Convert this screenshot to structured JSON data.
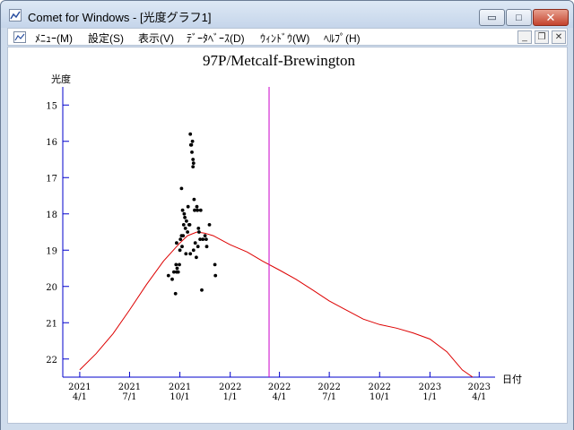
{
  "window": {
    "title": "Comet for Windows - [光度グラフ1]",
    "buttons": {
      "minimize": "▭",
      "maximize": "□",
      "close": "✕"
    }
  },
  "menubar": {
    "items": [
      {
        "label": "ﾒﾆｭｰ(M)"
      },
      {
        "label": "設定(S)"
      },
      {
        "label": "表示(V)"
      },
      {
        "label": "ﾃﾞｰﾀﾍﾞｰｽ(D)"
      },
      {
        "label": "ｳｨﾝﾄﾞｳ(W)"
      },
      {
        "label": "ﾍﾙﾌﾟ(H)"
      }
    ],
    "mdi_buttons": {
      "minimize": "_",
      "restore": "❐",
      "close": "✕"
    }
  },
  "chart_data": {
    "type": "scatter",
    "title": "97P/Metcalf-Brewington",
    "ylabel": "光度",
    "xlabel": "日付",
    "ylim": [
      22.5,
      14.5
    ],
    "xlim": [
      "2021-03-01",
      "2023-04-30"
    ],
    "y_inverted": true,
    "y_ticks": [
      "15",
      "16",
      "17",
      "18",
      "19",
      "20",
      "21",
      "22"
    ],
    "x_ticks": [
      {
        "date": "2021-04-01",
        "year": "2021",
        "md": "4/1"
      },
      {
        "date": "2021-07-01",
        "year": "2021",
        "md": "7/1"
      },
      {
        "date": "2021-10-01",
        "year": "2021",
        "md": "10/1"
      },
      {
        "date": "2022-01-01",
        "year": "2022",
        "md": "1/1"
      },
      {
        "date": "2022-04-01",
        "year": "2022",
        "md": "4/1"
      },
      {
        "date": "2022-07-01",
        "year": "2022",
        "md": "7/1"
      },
      {
        "date": "2022-10-01",
        "year": "2022",
        "md": "10/1"
      },
      {
        "date": "2023-01-01",
        "year": "2023",
        "md": "1/1"
      },
      {
        "date": "2023-04-01",
        "year": "2023",
        "md": "4/1"
      }
    ],
    "marker_line_date": "2022-03-13",
    "series": [
      {
        "kind": "observations",
        "color": "#000000",
        "points": [
          [
            "2021-09-10",
            19.7
          ],
          [
            "2021-09-17",
            19.8
          ],
          [
            "2021-09-20",
            19.6
          ],
          [
            "2021-09-23",
            20.2
          ],
          [
            "2021-09-24",
            19.4
          ],
          [
            "2021-09-25",
            19.6
          ],
          [
            "2021-09-25",
            18.8
          ],
          [
            "2021-09-26",
            19.5
          ],
          [
            "2021-09-28",
            19.6
          ],
          [
            "2021-09-30",
            19.4
          ],
          [
            "2021-10-01",
            19.0
          ],
          [
            "2021-10-02",
            18.7
          ],
          [
            "2021-10-04",
            17.3
          ],
          [
            "2021-10-04",
            18.6
          ],
          [
            "2021-10-05",
            18.9
          ],
          [
            "2021-10-06",
            17.9
          ],
          [
            "2021-10-07",
            18.6
          ],
          [
            "2021-10-08",
            18.3
          ],
          [
            "2021-10-09",
            18.0
          ],
          [
            "2021-10-10",
            18.1
          ],
          [
            "2021-10-11",
            18.4
          ],
          [
            "2021-10-12",
            19.1
          ],
          [
            "2021-10-13",
            18.2
          ],
          [
            "2021-10-15",
            18.5
          ],
          [
            "2021-10-16",
            17.8
          ],
          [
            "2021-10-18",
            18.3
          ],
          [
            "2021-10-19",
            18.3
          ],
          [
            "2021-10-20",
            19.1
          ],
          [
            "2021-10-20",
            15.8
          ],
          [
            "2021-10-21",
            16.1
          ],
          [
            "2021-10-22",
            16.1
          ],
          [
            "2021-10-23",
            16.3
          ],
          [
            "2021-10-24",
            16.0
          ],
          [
            "2021-10-25",
            16.7
          ],
          [
            "2021-10-25",
            16.5
          ],
          [
            "2021-10-26",
            16.6
          ],
          [
            "2021-10-26",
            19.0
          ],
          [
            "2021-10-27",
            17.6
          ],
          [
            "2021-10-28",
            17.9
          ],
          [
            "2021-10-29",
            18.8
          ],
          [
            "2021-10-31",
            19.2
          ],
          [
            "2021-11-01",
            17.8
          ],
          [
            "2021-11-02",
            17.9
          ],
          [
            "2021-11-03",
            18.9
          ],
          [
            "2021-11-04",
            18.4
          ],
          [
            "2021-11-05",
            18.5
          ],
          [
            "2021-11-07",
            18.7
          ],
          [
            "2021-11-08",
            17.9
          ],
          [
            "2021-11-10",
            20.1
          ],
          [
            "2021-11-12",
            18.7
          ],
          [
            "2021-11-16",
            18.6
          ],
          [
            "2021-11-18",
            18.7
          ],
          [
            "2021-11-19",
            18.9
          ],
          [
            "2021-11-24",
            18.3
          ],
          [
            "2021-12-04",
            19.4
          ],
          [
            "2021-12-05",
            19.7
          ]
        ]
      },
      {
        "kind": "prediction",
        "color": "#dd0000",
        "points": [
          [
            "2021-04-01",
            22.3
          ],
          [
            "2021-05-01",
            21.85
          ],
          [
            "2021-06-01",
            21.3
          ],
          [
            "2021-07-01",
            20.65
          ],
          [
            "2021-08-01",
            19.95
          ],
          [
            "2021-09-01",
            19.3
          ],
          [
            "2021-10-01",
            18.8
          ],
          [
            "2021-10-15",
            18.6
          ],
          [
            "2021-11-01",
            18.5
          ],
          [
            "2021-11-15",
            18.53
          ],
          [
            "2021-12-01",
            18.6
          ],
          [
            "2022-01-01",
            18.85
          ],
          [
            "2022-02-01",
            19.05
          ],
          [
            "2022-03-01",
            19.3
          ],
          [
            "2022-04-01",
            19.55
          ],
          [
            "2022-05-01",
            19.8
          ],
          [
            "2022-06-01",
            20.1
          ],
          [
            "2022-07-01",
            20.4
          ],
          [
            "2022-08-01",
            20.65
          ],
          [
            "2022-09-01",
            20.9
          ],
          [
            "2022-10-01",
            21.05
          ],
          [
            "2022-11-01",
            21.15
          ],
          [
            "2022-12-01",
            21.28
          ],
          [
            "2023-01-01",
            21.45
          ],
          [
            "2023-02-01",
            21.8
          ],
          [
            "2023-03-01",
            22.3
          ],
          [
            "2023-03-20",
            22.5
          ]
        ]
      }
    ],
    "colors": {
      "axis": "#0000cc",
      "marker_line": "#cc00cc",
      "prediction": "#dd0000",
      "points": "#000000"
    }
  }
}
